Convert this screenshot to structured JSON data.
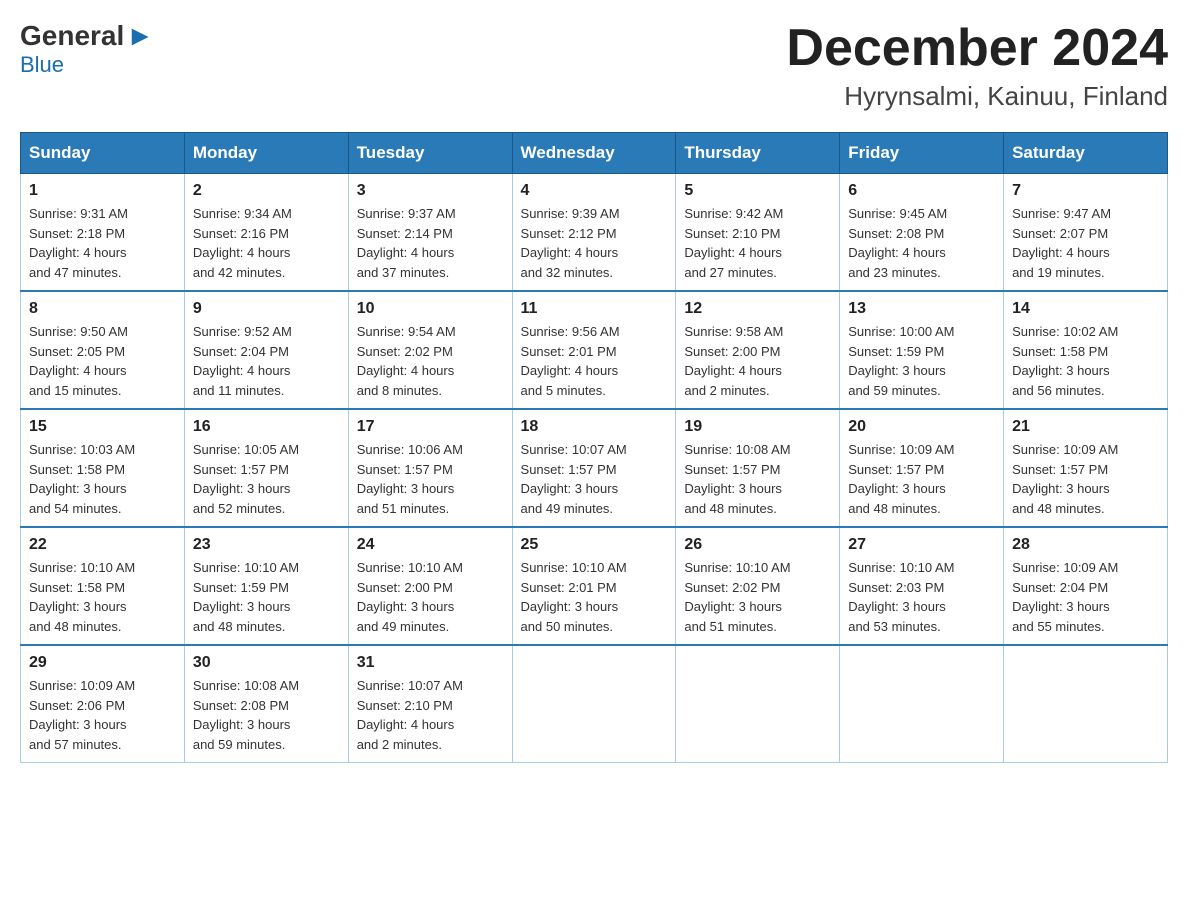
{
  "header": {
    "logo_general": "General",
    "logo_blue": "Blue",
    "month": "December 2024",
    "location": "Hyrynsalmi, Kainuu, Finland"
  },
  "weekdays": [
    "Sunday",
    "Monday",
    "Tuesday",
    "Wednesday",
    "Thursday",
    "Friday",
    "Saturday"
  ],
  "weeks": [
    [
      {
        "day": "1",
        "sunrise": "Sunrise: 9:31 AM",
        "sunset": "Sunset: 2:18 PM",
        "daylight": "Daylight: 4 hours",
        "minutes": "and 47 minutes."
      },
      {
        "day": "2",
        "sunrise": "Sunrise: 9:34 AM",
        "sunset": "Sunset: 2:16 PM",
        "daylight": "Daylight: 4 hours",
        "minutes": "and 42 minutes."
      },
      {
        "day": "3",
        "sunrise": "Sunrise: 9:37 AM",
        "sunset": "Sunset: 2:14 PM",
        "daylight": "Daylight: 4 hours",
        "minutes": "and 37 minutes."
      },
      {
        "day": "4",
        "sunrise": "Sunrise: 9:39 AM",
        "sunset": "Sunset: 2:12 PM",
        "daylight": "Daylight: 4 hours",
        "minutes": "and 32 minutes."
      },
      {
        "day": "5",
        "sunrise": "Sunrise: 9:42 AM",
        "sunset": "Sunset: 2:10 PM",
        "daylight": "Daylight: 4 hours",
        "minutes": "and 27 minutes."
      },
      {
        "day": "6",
        "sunrise": "Sunrise: 9:45 AM",
        "sunset": "Sunset: 2:08 PM",
        "daylight": "Daylight: 4 hours",
        "minutes": "and 23 minutes."
      },
      {
        "day": "7",
        "sunrise": "Sunrise: 9:47 AM",
        "sunset": "Sunset: 2:07 PM",
        "daylight": "Daylight: 4 hours",
        "minutes": "and 19 minutes."
      }
    ],
    [
      {
        "day": "8",
        "sunrise": "Sunrise: 9:50 AM",
        "sunset": "Sunset: 2:05 PM",
        "daylight": "Daylight: 4 hours",
        "minutes": "and 15 minutes."
      },
      {
        "day": "9",
        "sunrise": "Sunrise: 9:52 AM",
        "sunset": "Sunset: 2:04 PM",
        "daylight": "Daylight: 4 hours",
        "minutes": "and 11 minutes."
      },
      {
        "day": "10",
        "sunrise": "Sunrise: 9:54 AM",
        "sunset": "Sunset: 2:02 PM",
        "daylight": "Daylight: 4 hours",
        "minutes": "and 8 minutes."
      },
      {
        "day": "11",
        "sunrise": "Sunrise: 9:56 AM",
        "sunset": "Sunset: 2:01 PM",
        "daylight": "Daylight: 4 hours",
        "minutes": "and 5 minutes."
      },
      {
        "day": "12",
        "sunrise": "Sunrise: 9:58 AM",
        "sunset": "Sunset: 2:00 PM",
        "daylight": "Daylight: 4 hours",
        "minutes": "and 2 minutes."
      },
      {
        "day": "13",
        "sunrise": "Sunrise: 10:00 AM",
        "sunset": "Sunset: 1:59 PM",
        "daylight": "Daylight: 3 hours",
        "minutes": "and 59 minutes."
      },
      {
        "day": "14",
        "sunrise": "Sunrise: 10:02 AM",
        "sunset": "Sunset: 1:58 PM",
        "daylight": "Daylight: 3 hours",
        "minutes": "and 56 minutes."
      }
    ],
    [
      {
        "day": "15",
        "sunrise": "Sunrise: 10:03 AM",
        "sunset": "Sunset: 1:58 PM",
        "daylight": "Daylight: 3 hours",
        "minutes": "and 54 minutes."
      },
      {
        "day": "16",
        "sunrise": "Sunrise: 10:05 AM",
        "sunset": "Sunset: 1:57 PM",
        "daylight": "Daylight: 3 hours",
        "minutes": "and 52 minutes."
      },
      {
        "day": "17",
        "sunrise": "Sunrise: 10:06 AM",
        "sunset": "Sunset: 1:57 PM",
        "daylight": "Daylight: 3 hours",
        "minutes": "and 51 minutes."
      },
      {
        "day": "18",
        "sunrise": "Sunrise: 10:07 AM",
        "sunset": "Sunset: 1:57 PM",
        "daylight": "Daylight: 3 hours",
        "minutes": "and 49 minutes."
      },
      {
        "day": "19",
        "sunrise": "Sunrise: 10:08 AM",
        "sunset": "Sunset: 1:57 PM",
        "daylight": "Daylight: 3 hours",
        "minutes": "and 48 minutes."
      },
      {
        "day": "20",
        "sunrise": "Sunrise: 10:09 AM",
        "sunset": "Sunset: 1:57 PM",
        "daylight": "Daylight: 3 hours",
        "minutes": "and 48 minutes."
      },
      {
        "day": "21",
        "sunrise": "Sunrise: 10:09 AM",
        "sunset": "Sunset: 1:57 PM",
        "daylight": "Daylight: 3 hours",
        "minutes": "and 48 minutes."
      }
    ],
    [
      {
        "day": "22",
        "sunrise": "Sunrise: 10:10 AM",
        "sunset": "Sunset: 1:58 PM",
        "daylight": "Daylight: 3 hours",
        "minutes": "and 48 minutes."
      },
      {
        "day": "23",
        "sunrise": "Sunrise: 10:10 AM",
        "sunset": "Sunset: 1:59 PM",
        "daylight": "Daylight: 3 hours",
        "minutes": "and 48 minutes."
      },
      {
        "day": "24",
        "sunrise": "Sunrise: 10:10 AM",
        "sunset": "Sunset: 2:00 PM",
        "daylight": "Daylight: 3 hours",
        "minutes": "and 49 minutes."
      },
      {
        "day": "25",
        "sunrise": "Sunrise: 10:10 AM",
        "sunset": "Sunset: 2:01 PM",
        "daylight": "Daylight: 3 hours",
        "minutes": "and 50 minutes."
      },
      {
        "day": "26",
        "sunrise": "Sunrise: 10:10 AM",
        "sunset": "Sunset: 2:02 PM",
        "daylight": "Daylight: 3 hours",
        "minutes": "and 51 minutes."
      },
      {
        "day": "27",
        "sunrise": "Sunrise: 10:10 AM",
        "sunset": "Sunset: 2:03 PM",
        "daylight": "Daylight: 3 hours",
        "minutes": "and 53 minutes."
      },
      {
        "day": "28",
        "sunrise": "Sunrise: 10:09 AM",
        "sunset": "Sunset: 2:04 PM",
        "daylight": "Daylight: 3 hours",
        "minutes": "and 55 minutes."
      }
    ],
    [
      {
        "day": "29",
        "sunrise": "Sunrise: 10:09 AM",
        "sunset": "Sunset: 2:06 PM",
        "daylight": "Daylight: 3 hours",
        "minutes": "and 57 minutes."
      },
      {
        "day": "30",
        "sunrise": "Sunrise: 10:08 AM",
        "sunset": "Sunset: 2:08 PM",
        "daylight": "Daylight: 3 hours",
        "minutes": "and 59 minutes."
      },
      {
        "day": "31",
        "sunrise": "Sunrise: 10:07 AM",
        "sunset": "Sunset: 2:10 PM",
        "daylight": "Daylight: 4 hours",
        "minutes": "and 2 minutes."
      },
      null,
      null,
      null,
      null
    ]
  ]
}
